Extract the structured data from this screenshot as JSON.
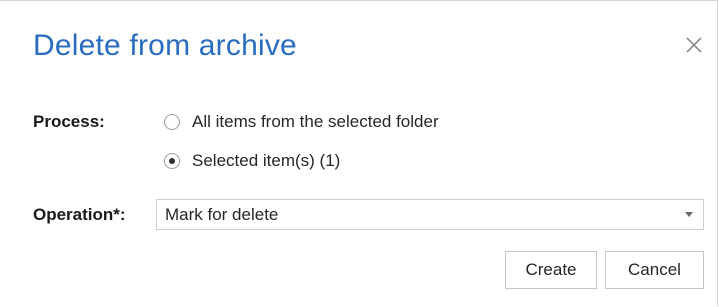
{
  "dialog": {
    "title": "Delete from archive",
    "close_icon": "close-icon"
  },
  "process": {
    "label": "Process:",
    "options": [
      {
        "label": "All items from the selected folder",
        "selected": false
      },
      {
        "label": "Selected item(s) (1)",
        "selected": true
      }
    ]
  },
  "operation": {
    "label": "Operation*:",
    "value": "Mark for delete",
    "caret_icon": "dropdown-caret-icon"
  },
  "buttons": {
    "create": "Create",
    "cancel": "Cancel"
  },
  "colors": {
    "title": "#2a6cc0"
  }
}
